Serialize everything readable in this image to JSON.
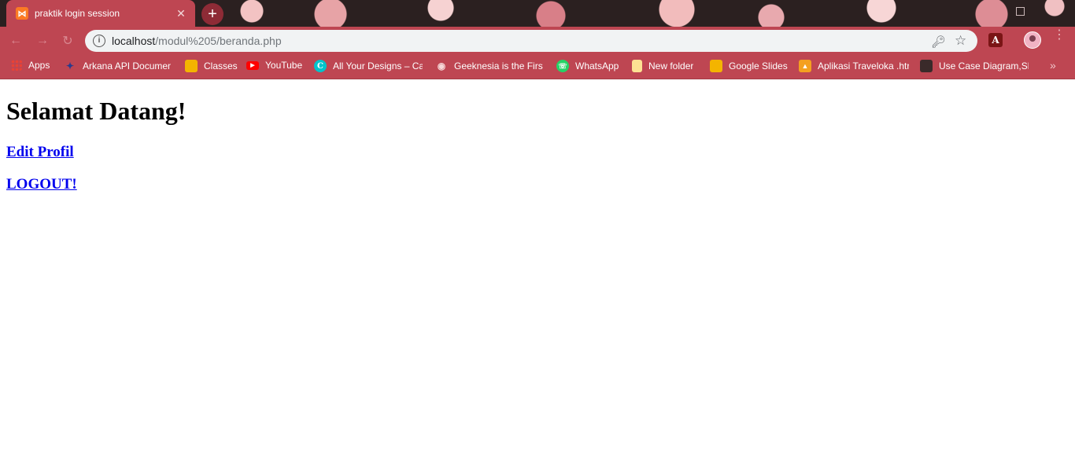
{
  "tab": {
    "title": "praktik login session",
    "favicon_letter": "⋈",
    "close_glyph": "✕"
  },
  "new_tab_glyph": "+",
  "address_bar": {
    "host": "localhost",
    "path": "/modul%205/beranda.php"
  },
  "bookmarks": [
    {
      "label": "Apps",
      "icon": "apps-grid-icon"
    },
    {
      "label": "Arkana API Documen",
      "icon": "bird-icon"
    },
    {
      "label": "Classes",
      "icon": "classroom-icon"
    },
    {
      "label": "YouTube",
      "icon": "youtube-icon"
    },
    {
      "label": "All Your Designs – Ca",
      "icon": "canva-icon"
    },
    {
      "label": "Geeknesia is the First",
      "icon": "geeknesia-icon"
    },
    {
      "label": "WhatsApp",
      "icon": "whatsapp-icon"
    },
    {
      "label": "New folder",
      "icon": "folder-icon"
    },
    {
      "label": "Google Slides",
      "icon": "slides-icon"
    },
    {
      "label": "Aplikasi Traveloka .htr",
      "icon": "drive-icon"
    },
    {
      "label": "Use Case Diagram,Sk",
      "icon": "image-icon"
    }
  ],
  "page": {
    "heading": "Selamat Datang!",
    "edit_profile": "Edit Profil",
    "logout": "LOGOUT!"
  },
  "colors": {
    "chrome_frame": "#be4652",
    "link": "#0000ee"
  }
}
